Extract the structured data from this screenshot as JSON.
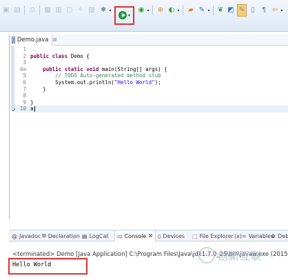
{
  "toolbar": {
    "icons": [
      "save-icon",
      "print-icon",
      "build-icon",
      "debug-icon",
      "run-icon",
      "coverage-icon",
      "external-tools-icon",
      "new-java-project-icon",
      "open-type-icon",
      "search-icon",
      "next-annotation-icon",
      "back-icon",
      "forward-icon"
    ]
  },
  "editor": {
    "tab_label": "Demo.java",
    "tab_close": "☒",
    "file_icon": "J",
    "lines": [
      {
        "num": "1",
        "marker": "",
        "parts": []
      },
      {
        "num": "2",
        "marker": "",
        "parts": [
          {
            "t": "public class",
            "c": "kw"
          },
          {
            "t": " Demo {",
            "c": ""
          }
        ]
      },
      {
        "num": "3",
        "marker": "",
        "parts": []
      },
      {
        "num": "4",
        "marker": "⊖",
        "parts": [
          {
            "t": "    public static void",
            "c": "kw"
          },
          {
            "t": " main(String[] args) {",
            "c": ""
          }
        ]
      },
      {
        "num": "5",
        "marker": "",
        "parts": [
          {
            "t": "        // TODO Auto-generated method stub",
            "c": "cm"
          }
        ]
      },
      {
        "num": "6",
        "marker": "",
        "parts": [
          {
            "t": "        System.out.println(",
            "c": ""
          },
          {
            "t": "\"Hello World\"",
            "c": "st"
          },
          {
            "t": ");",
            "c": ""
          }
        ]
      },
      {
        "num": "7",
        "marker": "",
        "parts": [
          {
            "t": "    }",
            "c": ""
          }
        ]
      },
      {
        "num": "8",
        "marker": "",
        "parts": []
      },
      {
        "num": "9",
        "marker": "",
        "parts": [
          {
            "t": "}",
            "c": ""
          }
        ]
      },
      {
        "num": "10",
        "marker": "",
        "parts": [
          {
            "t": "a",
            "c": ""
          }
        ]
      }
    ]
  },
  "console_panel": {
    "tabs": [
      {
        "label": "Javadoc",
        "icon": "@",
        "active": false
      },
      {
        "label": "Declaration",
        "icon": "⧉",
        "active": false
      },
      {
        "label": "LogCat",
        "icon": "▤",
        "active": false
      },
      {
        "label": "Console",
        "icon": "▭",
        "active": true,
        "close": "☒"
      },
      {
        "label": "Devices",
        "icon": "▯",
        "active": false
      },
      {
        "label": "File Explorer",
        "icon": "⬚",
        "active": false
      },
      {
        "label": "Variables",
        "icon": "(x)=",
        "active": false
      },
      {
        "label": "Deb",
        "icon": "⚙",
        "active": false
      }
    ],
    "terminated_text": "<terminated> Demo [Java Application] C:\\Program Files\\Java\\jdk1.7.0_25\\bin\\javaw.exe (2015",
    "output_text": "Hello World"
  },
  "watermark": {
    "logo_text": "✕",
    "text": "创新互联"
  },
  "colors": {
    "highlight": "#e0302a",
    "keyword": "#7f0055",
    "comment": "#3f7f5f",
    "string": "#2a00ff"
  }
}
